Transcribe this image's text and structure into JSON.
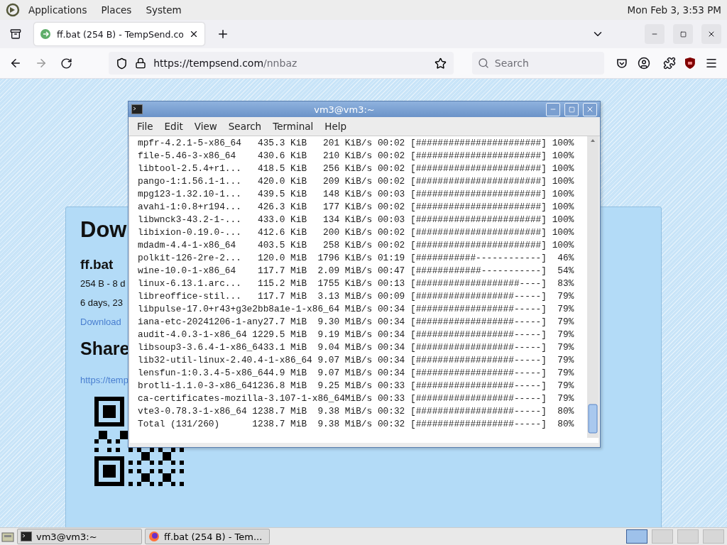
{
  "top_panel": {
    "menus": [
      "Applications",
      "Places",
      "System"
    ],
    "clock": "Mon Feb 3, 3:53 PM"
  },
  "browser": {
    "tabs": [
      {
        "title": "ff.bat (254 B) - TempSend.co",
        "selected": true
      }
    ],
    "url": {
      "host": "https://tempsend.com",
      "path": "/nnbaz"
    },
    "search": {
      "placeholder": "Search"
    }
  },
  "page": {
    "heading": "Dow",
    "file_name": "ff.bat",
    "file_info": "254 B - 8 d",
    "expiry": "6 days, 23",
    "download_link": "Download",
    "share_heading": "Share",
    "share_link": "https://temp"
  },
  "terminal": {
    "title": "vm3@vm3:~",
    "menus": [
      "File",
      "Edit",
      "View",
      "Search",
      "Terminal",
      "Help"
    ],
    "lines": [
      "mpfr-4.2.1-5-x86_64   435.3 KiB   201 KiB/s 00:02 [#######################] 100%",
      "file-5.46-3-x86_64    430.6 KiB   210 KiB/s 00:02 [#######################] 100%",
      "libtool-2.5.4+r1...   418.5 KiB   256 KiB/s 00:02 [#######################] 100%",
      "pango-1:1.56.1-1...   420.0 KiB   209 KiB/s 00:02 [#######################] 100%",
      "mpg123-1.32.10-1...   439.5 KiB   148 KiB/s 00:03 [#######################] 100%",
      "avahi-1:0.8+r194...   426.3 KiB   177 KiB/s 00:02 [#######################] 100%",
      "libwnck3-43.2-1-...   433.0 KiB   134 KiB/s 00:03 [#######################] 100%",
      "libixion-0.19.0-...   412.6 KiB   200 KiB/s 00:02 [#######################] 100%",
      "mdadm-4.4-1-x86_64    403.5 KiB   258 KiB/s 00:02 [#######################] 100%",
      "polkit-126-2re-2...   120.0 MiB  1796 KiB/s 01:19 [###########------------]  46%",
      "wine-10.0-1-x86_64    117.7 MiB  2.09 MiB/s 00:47 [############-----------]  54%",
      "linux-6.13.1.arc...   115.2 MiB  1755 KiB/s 00:13 [###################----]  83%",
      "libreoffice-stil...   117.7 MiB  3.13 MiB/s 00:09 [##################-----]  79%",
      "libpulse-17.0+r43+g3e2bb8a1e-1-x86_64 MiB/s 00:34 [##################-----]  79%",
      "iana-etc-20241206-1-any27.7 MiB  9.30 MiB/s 00:34 [##################-----]  79%",
      "audit-4.0.3-1-x86_64 1229.5 MiB  9.19 MiB/s 00:34 [##################-----]  79%",
      "libsoup3-3.6.4-1-x86_6433.1 MiB  9.04 MiB/s 00:34 [##################-----]  79%",
      "lib32-util-linux-2.40.4-1-x86_64 9.07 MiB/s 00:34 [##################-----]  79%",
      "lensfun-1:0.3.4-5-x86_644.9 MiB  9.07 MiB/s 00:34 [##################-----]  79%",
      "brotli-1.1.0-3-x86_641236.8 MiB  9.25 MiB/s 00:33 [##################-----]  79%",
      "ca-certificates-mozilla-3.107-1-x86_64MiB/s 00:33 [##################-----]  79%",
      "vte3-0.78.3-1-x86_64 1238.7 MiB  9.38 MiB/s 00:32 [##################-----]  80%",
      "Total (131/260)      1238.7 MiB  9.38 MiB/s 00:32 [##################-----]  80%"
    ]
  },
  "taskbar": {
    "items": [
      {
        "label": "vm3@vm3:~",
        "kind": "terminal"
      },
      {
        "label": "ff.bat (254 B) - Tem...",
        "kind": "browser"
      }
    ]
  }
}
